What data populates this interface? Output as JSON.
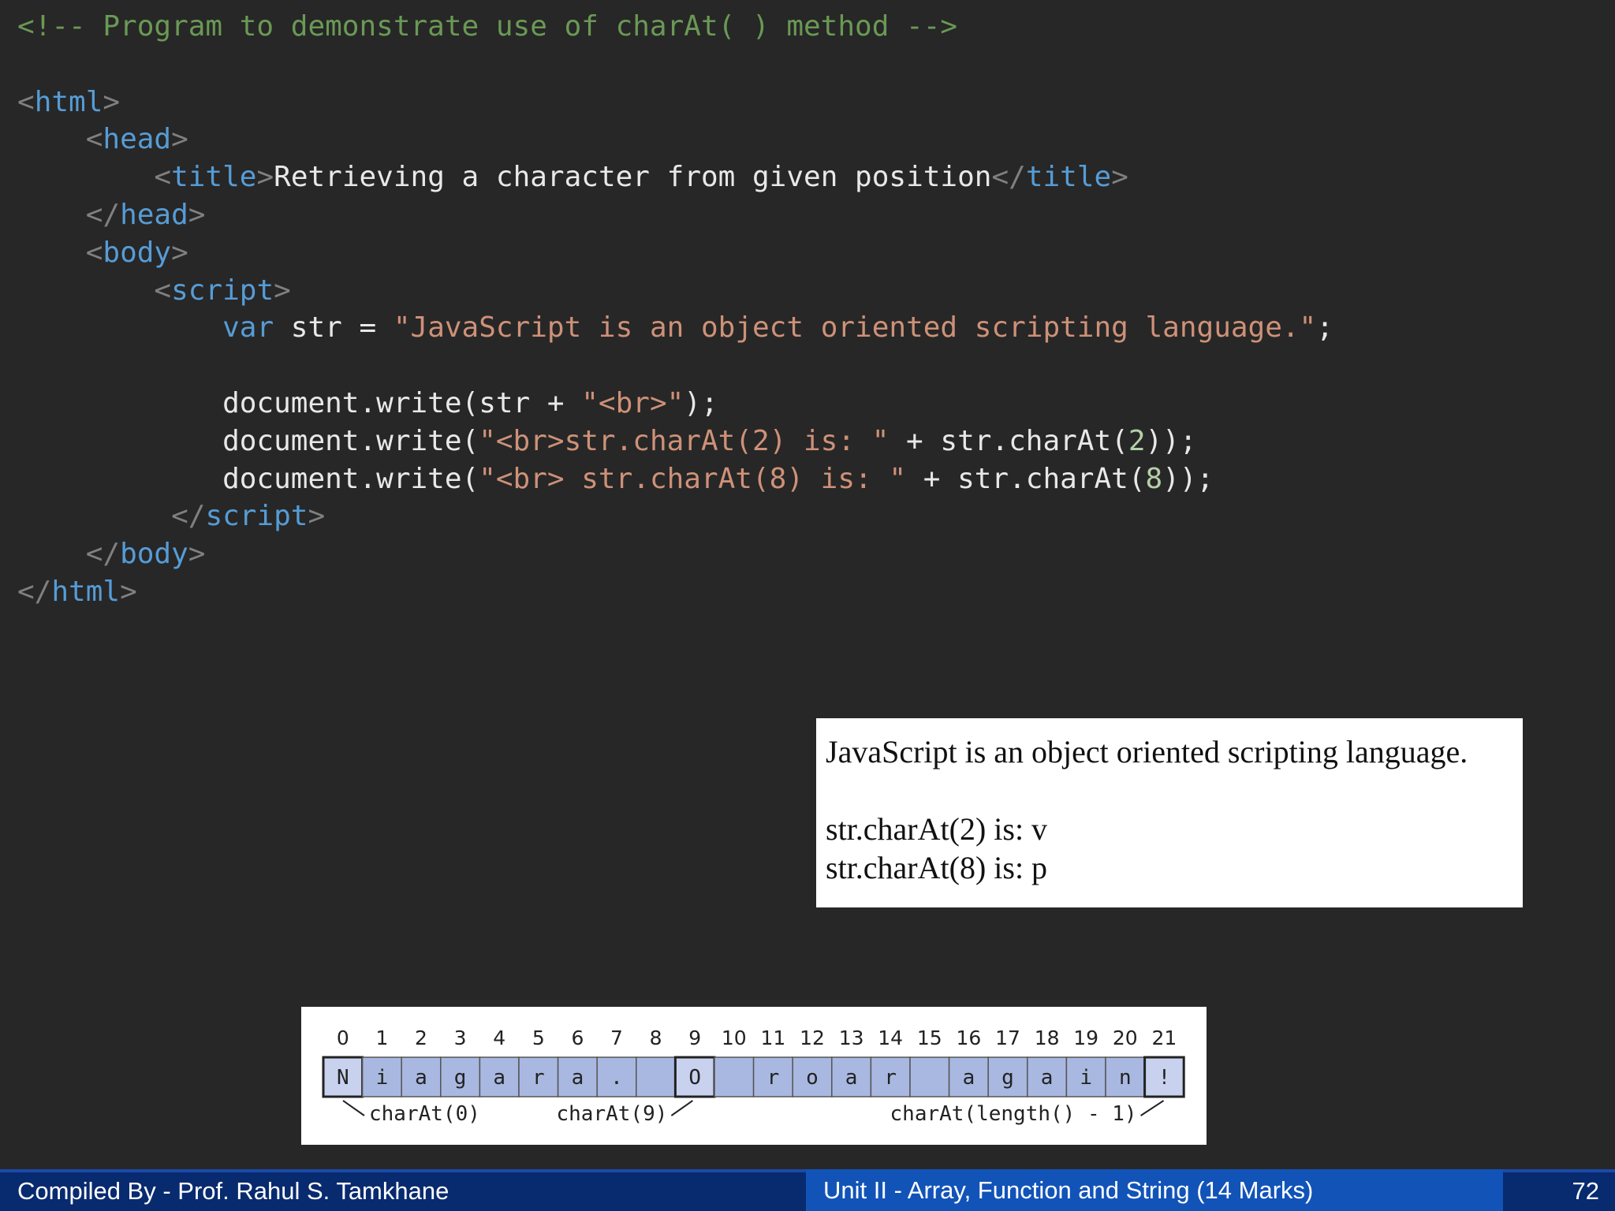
{
  "code": {
    "lines": [
      [
        [
          "cmt",
          "<!-- Program to demonstrate use of charAt( ) method -->"
        ]
      ],
      [],
      [
        [
          "br",
          "<"
        ],
        [
          "tag",
          "html"
        ],
        [
          "br",
          ">"
        ]
      ],
      [
        [
          "txt",
          "    "
        ],
        [
          "br",
          "<"
        ],
        [
          "tag",
          "head"
        ],
        [
          "br",
          ">"
        ]
      ],
      [
        [
          "txt",
          "        "
        ],
        [
          "br",
          "<"
        ],
        [
          "tag",
          "title"
        ],
        [
          "br",
          ">"
        ],
        [
          "txt",
          "Retrieving a character from given position"
        ],
        [
          "br",
          "</"
        ],
        [
          "tag",
          "title"
        ],
        [
          "br",
          ">"
        ]
      ],
      [
        [
          "txt",
          "    "
        ],
        [
          "br",
          "</"
        ],
        [
          "tag",
          "head"
        ],
        [
          "br",
          ">"
        ]
      ],
      [
        [
          "txt",
          "    "
        ],
        [
          "br",
          "<"
        ],
        [
          "tag",
          "body"
        ],
        [
          "br",
          ">"
        ]
      ],
      [
        [
          "txt",
          "        "
        ],
        [
          "br",
          "<"
        ],
        [
          "tag",
          "script"
        ],
        [
          "br",
          ">"
        ]
      ],
      [
        [
          "txt",
          "            "
        ],
        [
          "kw",
          "var"
        ],
        [
          "txt",
          " str = "
        ],
        [
          "str",
          "\"JavaScript is an object oriented scripting language.\""
        ],
        [
          "txt",
          ";"
        ]
      ],
      [],
      [
        [
          "txt",
          "            document.write(str + "
        ],
        [
          "str",
          "\"<br>\""
        ],
        [
          "txt",
          ");"
        ]
      ],
      [
        [
          "txt",
          "            document.write("
        ],
        [
          "str",
          "\"<br>str.charAt(2) is: \""
        ],
        [
          "txt",
          " + str.charAt("
        ],
        [
          "num",
          "2"
        ],
        [
          "txt",
          "));"
        ]
      ],
      [
        [
          "txt",
          "            document.write("
        ],
        [
          "str",
          "\"<br> str.charAt(8) is: \""
        ],
        [
          "txt",
          " + str.charAt("
        ],
        [
          "num",
          "8"
        ],
        [
          "txt",
          "));"
        ]
      ],
      [
        [
          "txt",
          "         "
        ],
        [
          "br",
          "</"
        ],
        [
          "tag",
          "script"
        ],
        [
          "br",
          ">"
        ]
      ],
      [
        [
          "txt",
          "    "
        ],
        [
          "br",
          "</"
        ],
        [
          "tag",
          "body"
        ],
        [
          "br",
          ">"
        ]
      ],
      [
        [
          "br",
          "</"
        ],
        [
          "tag",
          "html"
        ],
        [
          "br",
          ">"
        ]
      ]
    ]
  },
  "output": {
    "line1": "JavaScript is an object oriented scripting language.",
    "line2": "str.charAt(2) is: v",
    "line3": "str.charAt(8) is: p"
  },
  "diagram": {
    "indices": [
      "0",
      "1",
      "2",
      "3",
      "4",
      "5",
      "6",
      "7",
      "8",
      "9",
      "10",
      "11",
      "12",
      "13",
      "14",
      "15",
      "16",
      "17",
      "18",
      "19",
      "20",
      "21"
    ],
    "chars": [
      "N",
      "i",
      "a",
      "g",
      "a",
      "r",
      "a",
      ".",
      "",
      "O",
      "",
      "r",
      "o",
      "a",
      "r",
      "",
      "a",
      "g",
      "a",
      "i",
      "n",
      "!"
    ],
    "highlighted": [
      0,
      9,
      21
    ],
    "labels": {
      "first": "charAt(0)",
      "ninth": "charAt(9)",
      "last": "charAt(length() - 1)"
    },
    "colors": {
      "cell_fill": "#a8b8e0",
      "highlight_fill": "#c8d2ee",
      "cell_border": "#555555"
    }
  },
  "footer": {
    "author": "Compiled By - Prof. Rahul S. Tamkhane",
    "unit": "Unit II - Array, Function and String (14 Marks)",
    "page": "72"
  },
  "colors": {
    "background": "#272727",
    "comment": "#6a9955",
    "tag": "#569cd6",
    "string": "#ce9178",
    "number": "#b5cea8",
    "footer_dark": "#082a6f",
    "footer_mid": "#1253b8"
  }
}
